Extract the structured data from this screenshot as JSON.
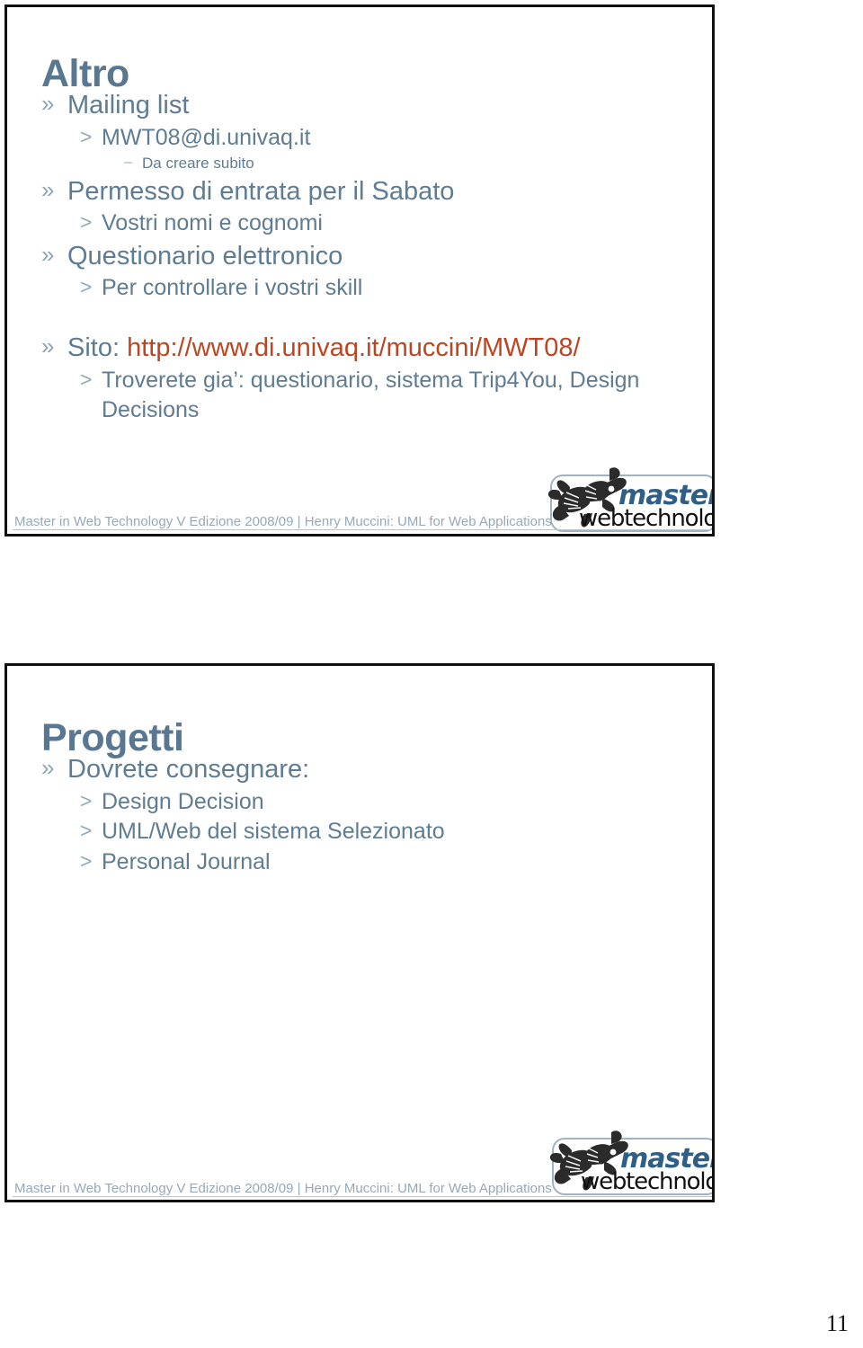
{
  "document": {
    "page_number": "11"
  },
  "slides": [
    {
      "title": "Altro",
      "footer": "Master in Web Technology V Edizione 2008/09 | Henry Muccini: UML for Web Applications",
      "logo": {
        "brand_top": "master",
        "brand_bottom": "webtechnology",
        "icon": "gecko-logo-icon"
      },
      "bullets": [
        {
          "level": 1,
          "mark": "»",
          "text": "Mailing list"
        },
        {
          "level": 2,
          "mark": ">",
          "text": "MWT08@di.univaq.it"
        },
        {
          "level": 3,
          "mark": "–",
          "text": "Da creare subito"
        },
        {
          "level": 1,
          "mark": "»",
          "text": "Permesso di entrata per il Sabato"
        },
        {
          "level": 2,
          "mark": ">",
          "text": "Vostri nomi e cognomi"
        },
        {
          "level": 1,
          "mark": "»",
          "text": "Questionario elettronico"
        },
        {
          "level": 2,
          "mark": ">",
          "text": "Per controllare i vostri skill"
        },
        {
          "level": 1,
          "mark": "»",
          "text": "Sito: ",
          "url": "http://www.di.univaq.it/muccini/MWT08/"
        },
        {
          "level": 2,
          "mark": ">",
          "text": "Troverete gia’: questionario, sistema Trip4You, Design Decisions"
        }
      ]
    },
    {
      "title": "Progetti",
      "footer": "Master in Web Technology V Edizione 2008/09 | Henry Muccini: UML for Web Applications",
      "logo": {
        "brand_top": "master",
        "brand_bottom": "webtechnology",
        "icon": "gecko-logo-icon"
      },
      "bullets": [
        {
          "level": 1,
          "mark": "»",
          "text": "Dovrete consegnare:"
        },
        {
          "level": 2,
          "mark": ">",
          "text": "Design Decision"
        },
        {
          "level": 2,
          "mark": ">",
          "text": "UML/Web del sistema Selezionato"
        },
        {
          "level": 2,
          "mark": ">",
          "text": "Personal Journal"
        }
      ]
    }
  ],
  "colors": {
    "title": "#5A7791",
    "body_text": "#5E7C92",
    "bullet_mark": "#8FA5B5",
    "url": "#BF4420",
    "footer": "#97A9B9",
    "frame": "#111111"
  }
}
